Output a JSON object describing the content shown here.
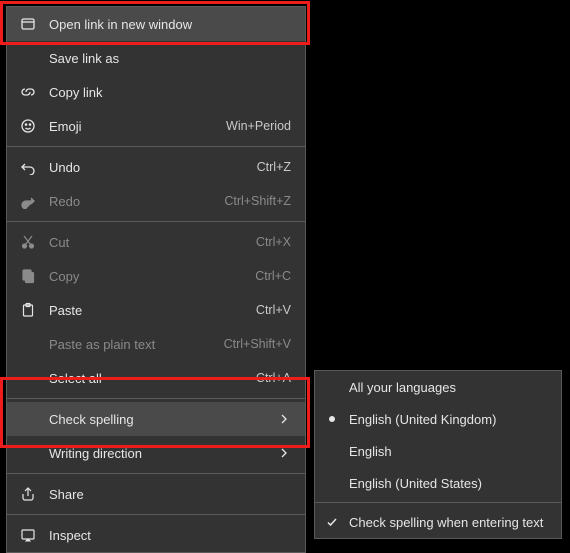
{
  "menu": {
    "open_new_window": "Open link in new window",
    "save_link_as": "Save link as",
    "copy_link": "Copy link",
    "emoji": "Emoji",
    "emoji_shortcut": "Win+Period",
    "undo": "Undo",
    "undo_shortcut": "Ctrl+Z",
    "redo": "Redo",
    "redo_shortcut": "Ctrl+Shift+Z",
    "cut": "Cut",
    "cut_shortcut": "Ctrl+X",
    "copy": "Copy",
    "copy_shortcut": "Ctrl+C",
    "paste": "Paste",
    "paste_shortcut": "Ctrl+V",
    "paste_plain": "Paste as plain text",
    "paste_plain_shortcut": "Ctrl+Shift+V",
    "select_all": "Select all",
    "select_all_shortcut": "Ctrl+A",
    "check_spelling": "Check spelling",
    "writing_direction": "Writing direction",
    "share": "Share",
    "inspect": "Inspect"
  },
  "submenu": {
    "all_languages": "All your languages",
    "en_uk": "English (United Kingdom)",
    "en": "English",
    "en_us": "English (United States)",
    "check_when_typing": "Check spelling when entering text"
  }
}
